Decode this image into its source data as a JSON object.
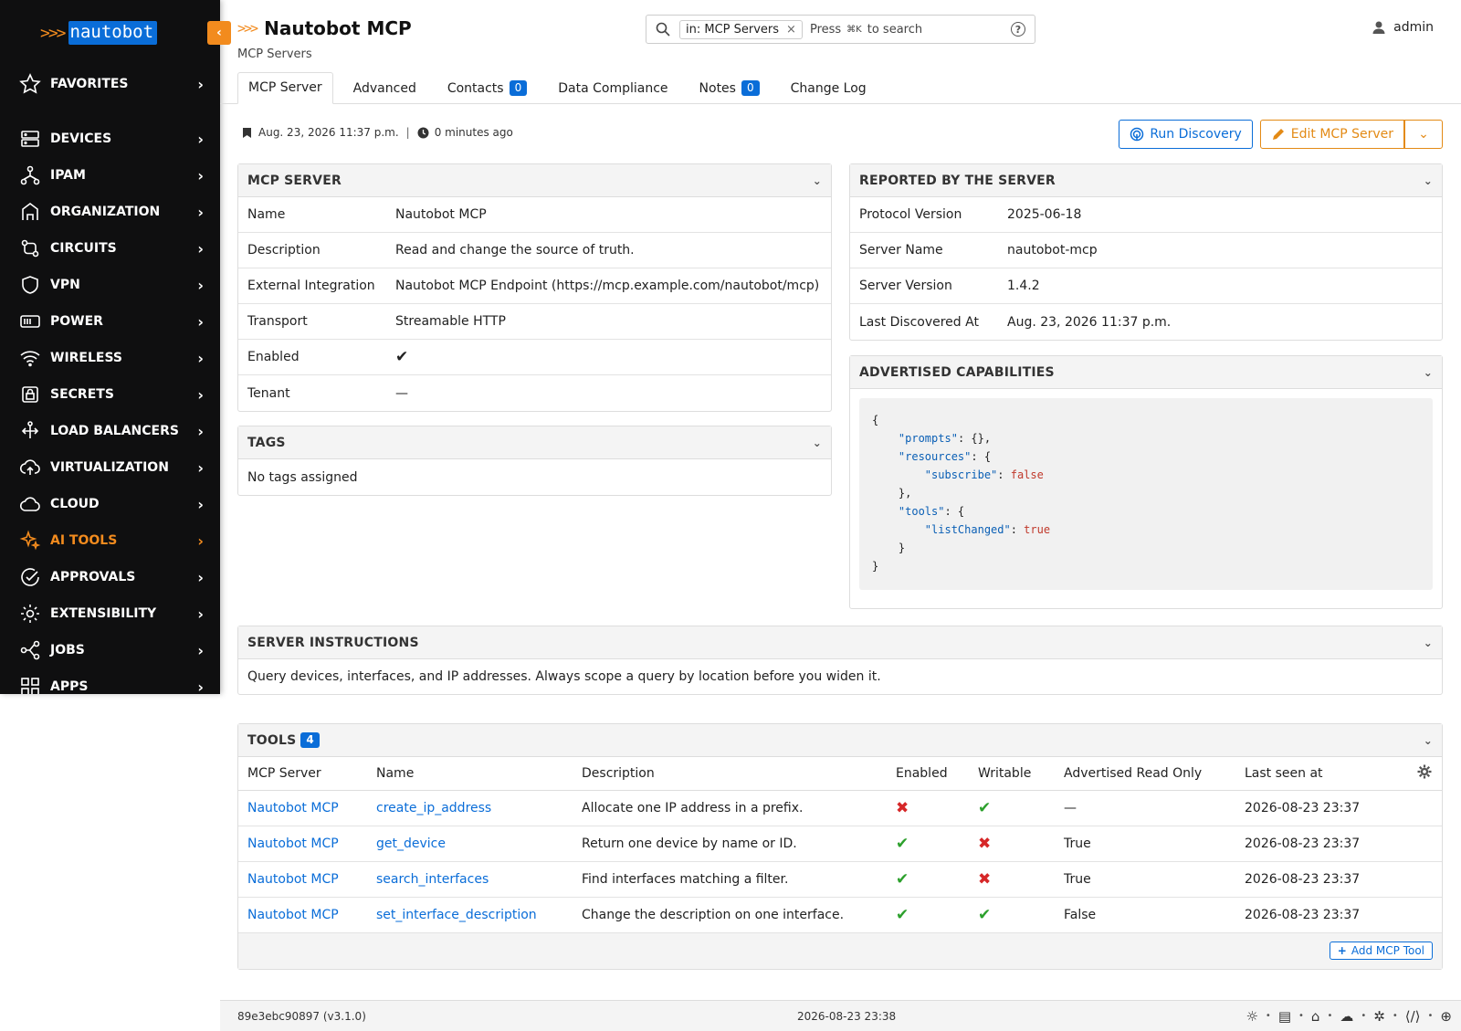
{
  "app": {
    "logo_chevrons": ">>>",
    "logo_word": "nautobot"
  },
  "sidebar": {
    "items": [
      {
        "label": "FAVORITES",
        "icon": "star-icon"
      },
      {
        "label": "DEVICES",
        "icon": "server-icon"
      },
      {
        "label": "IPAM",
        "icon": "network-icon"
      },
      {
        "label": "ORGANIZATION",
        "icon": "building-icon"
      },
      {
        "label": "CIRCUITS",
        "icon": "circuit-icon"
      },
      {
        "label": "VPN",
        "icon": "shield-icon"
      },
      {
        "label": "POWER",
        "icon": "power-icon"
      },
      {
        "label": "WIRELESS",
        "icon": "wifi-icon"
      },
      {
        "label": "SECRETS",
        "icon": "lock-icon"
      },
      {
        "label": "LOAD BALANCERS",
        "icon": "balancer-icon"
      },
      {
        "label": "VIRTUALIZATION",
        "icon": "cloud-upload-icon"
      },
      {
        "label": "CLOUD",
        "icon": "cloud-icon"
      },
      {
        "label": "AI TOOLS",
        "icon": "sparkle-icon",
        "active": true
      },
      {
        "label": "APPROVALS",
        "icon": "check-circle-icon"
      },
      {
        "label": "EXTENSIBILITY",
        "icon": "gear-icon"
      },
      {
        "label": "JOBS",
        "icon": "jobs-icon"
      },
      {
        "label": "APPS",
        "icon": "apps-icon"
      }
    ],
    "accent": "#f28b1e"
  },
  "header": {
    "title_chevrons": ">>>",
    "title": "Nautobot MCP",
    "breadcrumb": "MCP Servers",
    "search": {
      "chip": "in: MCP Servers",
      "press": "Press",
      "shortcut": "⌘K",
      "suffix": "to search"
    },
    "user": "admin",
    "tabs": [
      {
        "label": "MCP Server",
        "active": true
      },
      {
        "label": "Advanced"
      },
      {
        "label": "Contacts",
        "badge": "0"
      },
      {
        "label": "Data Compliance"
      },
      {
        "label": "Notes",
        "badge": "0"
      },
      {
        "label": "Change Log"
      }
    ]
  },
  "meta": {
    "created": "Aug. 23, 2026 11:37 p.m.",
    "sep": "|",
    "updated": "0 minutes ago"
  },
  "actions": {
    "run_discovery": "Run Discovery",
    "edit": "Edit MCP Server"
  },
  "mcp_server": {
    "title": "MCP SERVER",
    "rows": [
      {
        "k": "Name",
        "v": "Nautobot MCP"
      },
      {
        "k": "Description",
        "v": "Read and change the source of truth."
      },
      {
        "k": "External Integration",
        "v": "Nautobot MCP Endpoint (https://mcp.example.com/nautobot/mcp)"
      },
      {
        "k": "Transport",
        "v": "Streamable HTTP"
      },
      {
        "k": "Enabled",
        "v": "✔"
      },
      {
        "k": "Tenant",
        "v": "—"
      }
    ]
  },
  "tags": {
    "title": "TAGS",
    "empty": "No tags assigned"
  },
  "reported": {
    "title": "REPORTED BY THE SERVER",
    "rows": [
      {
        "k": "Protocol Version",
        "v": "2025-06-18"
      },
      {
        "k": "Server Name",
        "v": "nautobot-mcp"
      },
      {
        "k": "Server Version",
        "v": "1.4.2"
      },
      {
        "k": "Last Discovered At",
        "v": "Aug. 23, 2026 11:37 p.m."
      }
    ]
  },
  "capabilities": {
    "title": "ADVERTISED CAPABILITIES",
    "lines": [
      {
        "indent": "",
        "parts": [
          {
            "t": "{"
          }
        ]
      },
      {
        "indent": "    ",
        "parts": [
          {
            "t": "\"prompts\"",
            "c": "key"
          },
          {
            "t": ": {},"
          }
        ]
      },
      {
        "indent": "    ",
        "parts": [
          {
            "t": "\"resources\"",
            "c": "key"
          },
          {
            "t": ": {"
          }
        ]
      },
      {
        "indent": "        ",
        "parts": [
          {
            "t": "\"subscribe\"",
            "c": "key"
          },
          {
            "t": ": "
          },
          {
            "t": "false",
            "c": "bool"
          }
        ]
      },
      {
        "indent": "    ",
        "parts": [
          {
            "t": "},"
          }
        ]
      },
      {
        "indent": "    ",
        "parts": [
          {
            "t": "\"tools\"",
            "c": "key"
          },
          {
            "t": ": {"
          }
        ]
      },
      {
        "indent": "        ",
        "parts": [
          {
            "t": "\"listChanged\"",
            "c": "key"
          },
          {
            "t": ": "
          },
          {
            "t": "true",
            "c": "bool"
          }
        ]
      },
      {
        "indent": "    ",
        "parts": [
          {
            "t": "}"
          }
        ]
      },
      {
        "indent": "",
        "parts": [
          {
            "t": "}"
          }
        ]
      }
    ]
  },
  "instructions": {
    "title": "SERVER INSTRUCTIONS",
    "text": "Query devices, interfaces, and IP addresses. Always scope a query by location before you widen it."
  },
  "tools": {
    "title": "TOOLS",
    "count": "4",
    "columns": [
      "MCP Server",
      "Name",
      "Description",
      "Enabled",
      "Writable",
      "Advertised Read Only",
      "Last seen at"
    ],
    "rows": [
      {
        "server": "Nautobot MCP",
        "name": "create_ip_address",
        "description": "Allocate one IP address in a prefix.",
        "enabled": false,
        "writable": true,
        "read_only": "—",
        "last_seen": "2026-08-23 23:37"
      },
      {
        "server": "Nautobot MCP",
        "name": "get_device",
        "description": "Return one device by name or ID.",
        "enabled": true,
        "writable": false,
        "read_only": "True",
        "last_seen": "2026-08-23 23:37"
      },
      {
        "server": "Nautobot MCP",
        "name": "search_interfaces",
        "description": "Find interfaces matching a filter.",
        "enabled": true,
        "writable": false,
        "read_only": "True",
        "last_seen": "2026-08-23 23:37"
      },
      {
        "server": "Nautobot MCP",
        "name": "set_interface_description",
        "description": "Change the description on one interface.",
        "enabled": true,
        "writable": true,
        "read_only": "False",
        "last_seen": "2026-08-23 23:37"
      }
    ],
    "add_label": "Add MCP Tool"
  },
  "footer": {
    "version": "89e3ebc90897 (v3.1.0)",
    "time": "2026-08-23 23:38"
  },
  "colors": {
    "link": "#0a6dd8",
    "accent": "#f28b1e",
    "check": "#2ca02c",
    "cross": "#d62728"
  }
}
